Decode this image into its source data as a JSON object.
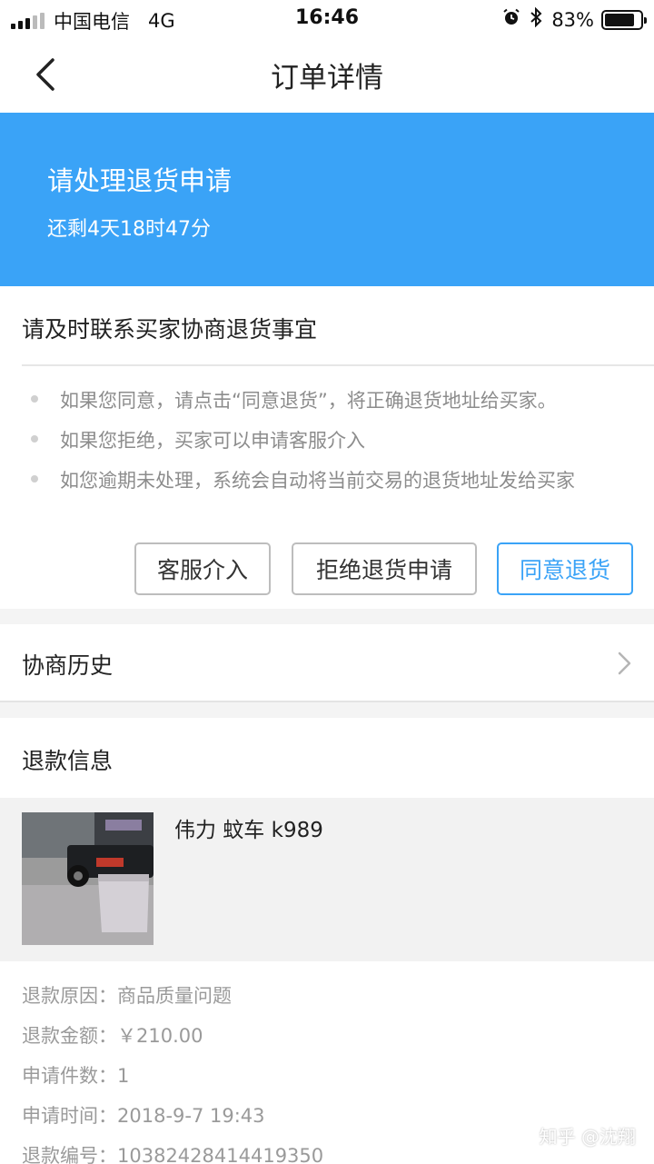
{
  "status_bar": {
    "carrier": "中国电信",
    "network": "4G",
    "time": "16:46",
    "battery": "83%",
    "battery_level": 0.83,
    "icons": [
      "alarm-icon",
      "bluetooth-icon"
    ]
  },
  "nav": {
    "title": "订单详情",
    "back_icon": "chevron-left-icon"
  },
  "banner": {
    "title": "请处理退货申请",
    "countdown": "还剩4天18时47分",
    "color": "#3aa3f7"
  },
  "notice": {
    "title": "请及时联系买家协商退货事宜",
    "tips": [
      "如果您同意，请点击“同意退货”，将正确退货地址给买家。",
      "如果您拒绝，买家可以申请客服介入",
      "如您逾期未处理，系统会自动将当前交易的退货地址发给买家"
    ]
  },
  "actions": {
    "kefu": "客服介入",
    "reject": "拒绝退货申请",
    "agree": "同意退货"
  },
  "history": {
    "label": "协商历史"
  },
  "refund": {
    "title": "退款信息",
    "product_name": "伟力 蚊车 k989",
    "rows": [
      {
        "label": "退款原因：",
        "value": "商品质量问题"
      },
      {
        "label": "退款金额：",
        "value": "￥210.00"
      },
      {
        "label": "申请件数：",
        "value": "1"
      },
      {
        "label": "申请时间：",
        "value": "2018-9-7 19:43"
      },
      {
        "label": "退款编号：",
        "value": "10382428414419350"
      }
    ]
  },
  "watermark": "知乎 @沈翔"
}
